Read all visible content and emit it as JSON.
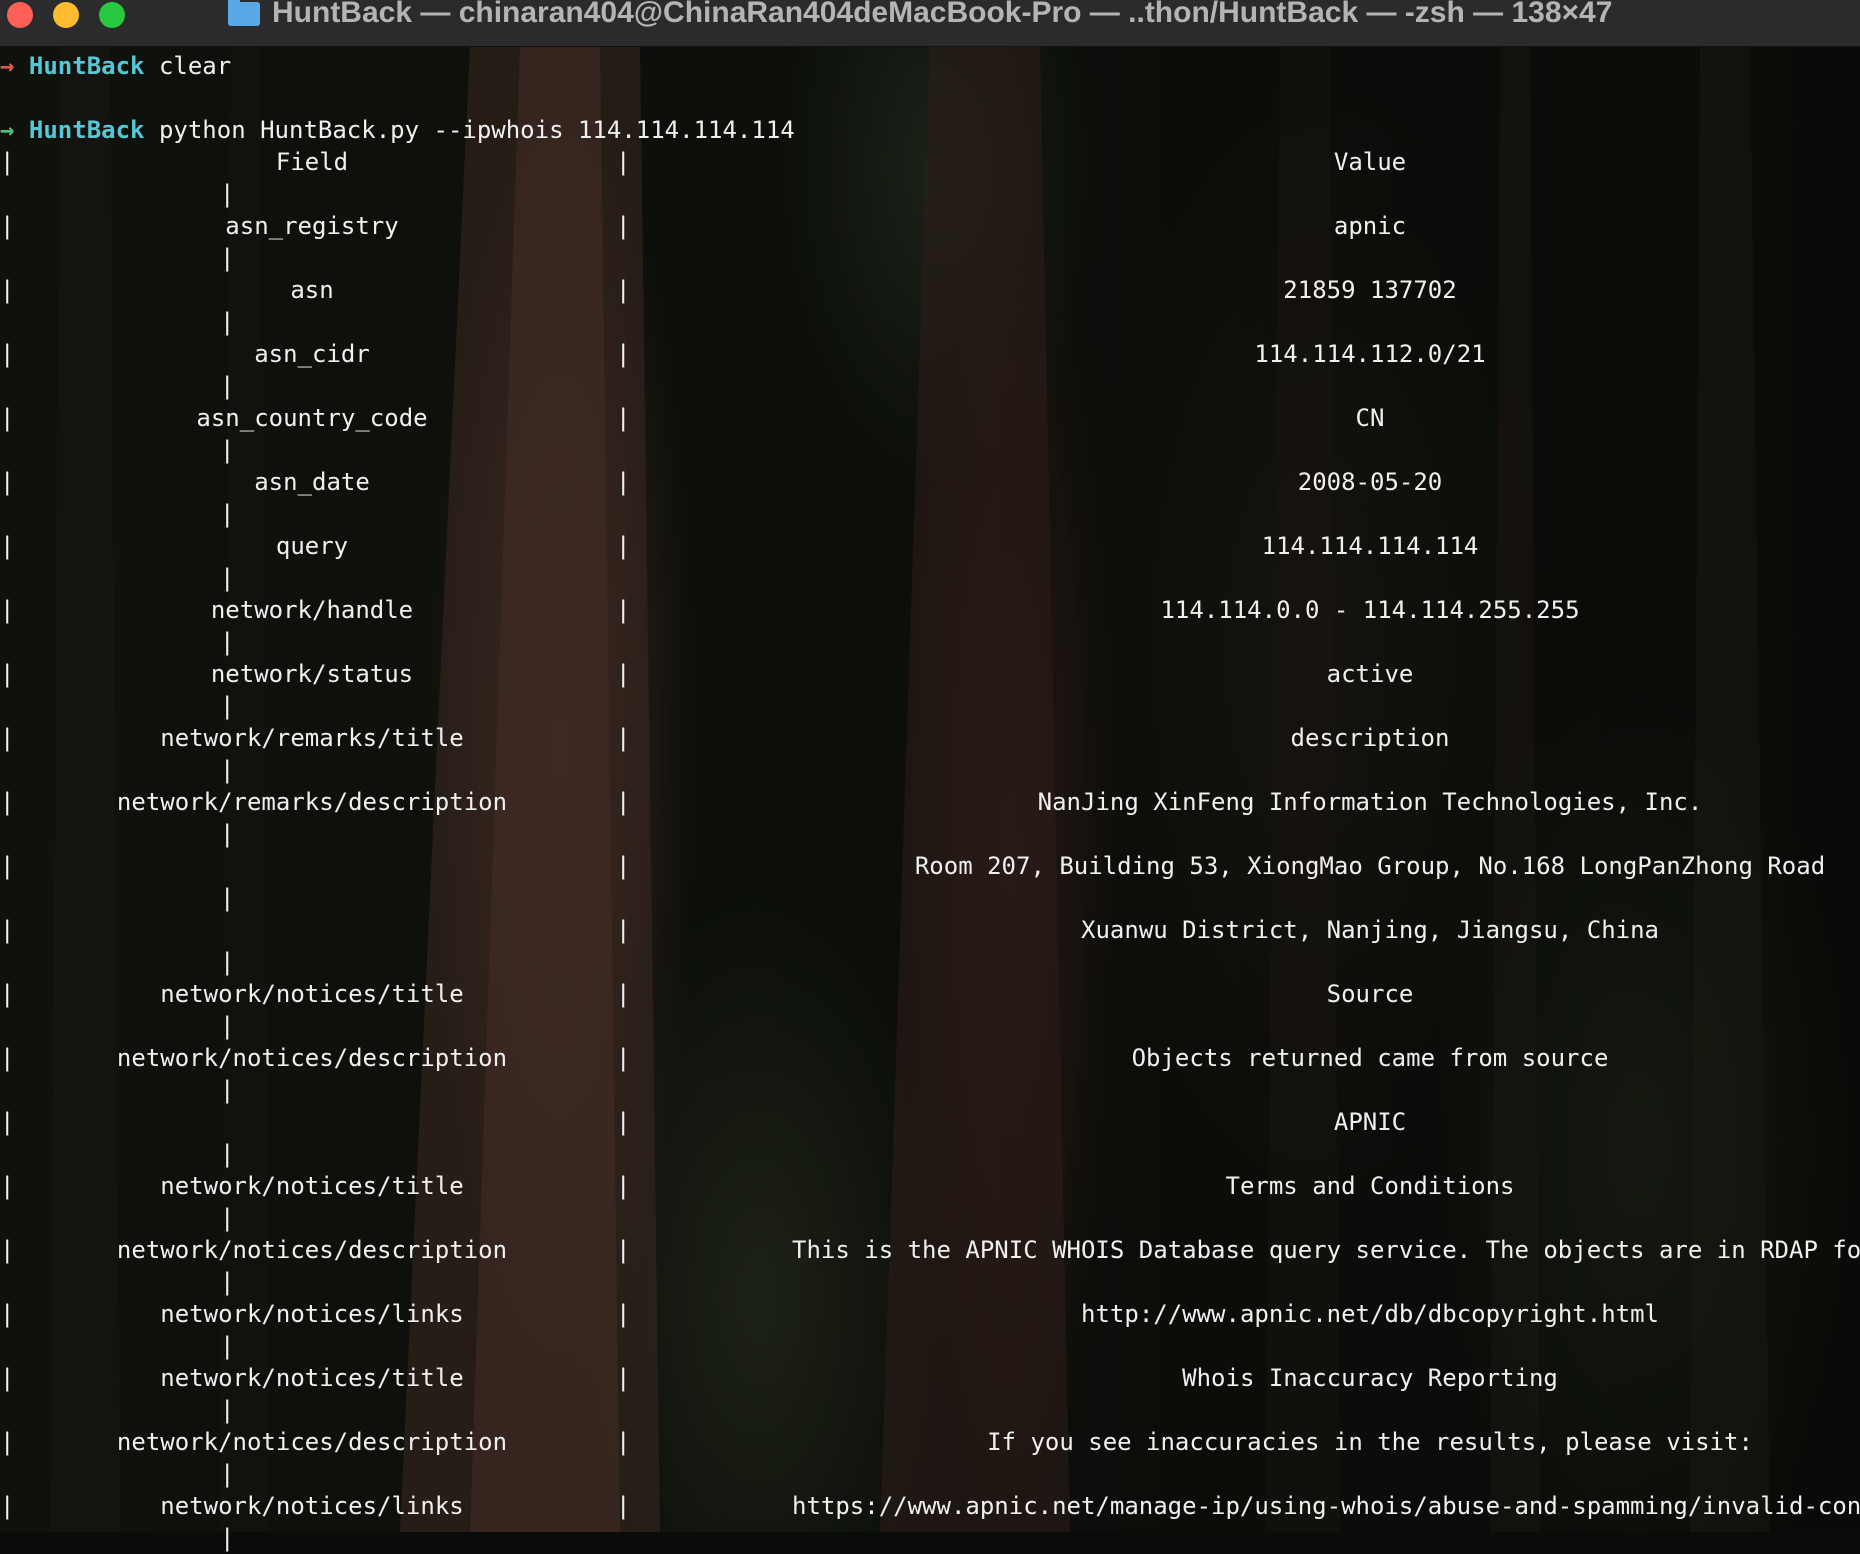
{
  "window": {
    "title": "HuntBack — chinaran404@ChinaRan404deMacBook-Pro — ..thon/HuntBack — -zsh — 138×47"
  },
  "prompts": [
    {
      "arrow": "→",
      "dir": "HuntBack",
      "command": "clear"
    },
    {
      "arrow": "→",
      "dir": "HuntBack",
      "command": "python HuntBack.py --ipwhois 114.114.114.114"
    }
  ],
  "table": {
    "separator": "|",
    "header": {
      "field": "Field",
      "value": "Value"
    },
    "rows": [
      {
        "field": "asn_registry",
        "value": "apnic"
      },
      {
        "field": "asn",
        "value": "21859 137702"
      },
      {
        "field": "asn_cidr",
        "value": "114.114.112.0/21"
      },
      {
        "field": "asn_country_code",
        "value": "CN"
      },
      {
        "field": "asn_date",
        "value": "2008-05-20"
      },
      {
        "field": "query",
        "value": "114.114.114.114"
      },
      {
        "field": "network/handle",
        "value": "114.114.0.0 - 114.114.255.255"
      },
      {
        "field": "network/status",
        "value": "active"
      },
      {
        "field": "network/remarks/title",
        "value": "description"
      },
      {
        "field": "network/remarks/description",
        "value": "NanJing XinFeng Information Technologies, Inc."
      },
      {
        "field": "",
        "value": "Room 207, Building 53, XiongMao Group, No.168 LongPanZhong Road"
      },
      {
        "field": "",
        "value": "Xuanwu District, Nanjing, Jiangsu, China"
      },
      {
        "field": "network/notices/title",
        "value": "Source"
      },
      {
        "field": "network/notices/description",
        "value": "Objects returned came from source"
      },
      {
        "field": "",
        "value": "APNIC"
      },
      {
        "field": "network/notices/title",
        "value": "Terms and Conditions"
      },
      {
        "field": "network/notices/description",
        "value": "This is the APNIC WHOIS Database query service. The objects are in RDAP form"
      },
      {
        "field": "network/notices/links",
        "value": "http://www.apnic.net/db/dbcopyright.html"
      },
      {
        "field": "network/notices/title",
        "value": "Whois Inaccuracy Reporting"
      },
      {
        "field": "network/notices/description",
        "value": "If you see inaccuracies in the results, please visit:"
      },
      {
        "field": "network/notices/links",
        "value": "https://www.apnic.net/manage-ip/using-whois/abuse-and-spamming/invalid-contact"
      }
    ]
  },
  "colors": {
    "prompt_arrow_error": "#e05a4a",
    "prompt_arrow_ok": "#4ec27a",
    "prompt_dir": "#56c7d6",
    "text": "#f0f0f0",
    "titlebar": "#2b2b2d"
  }
}
